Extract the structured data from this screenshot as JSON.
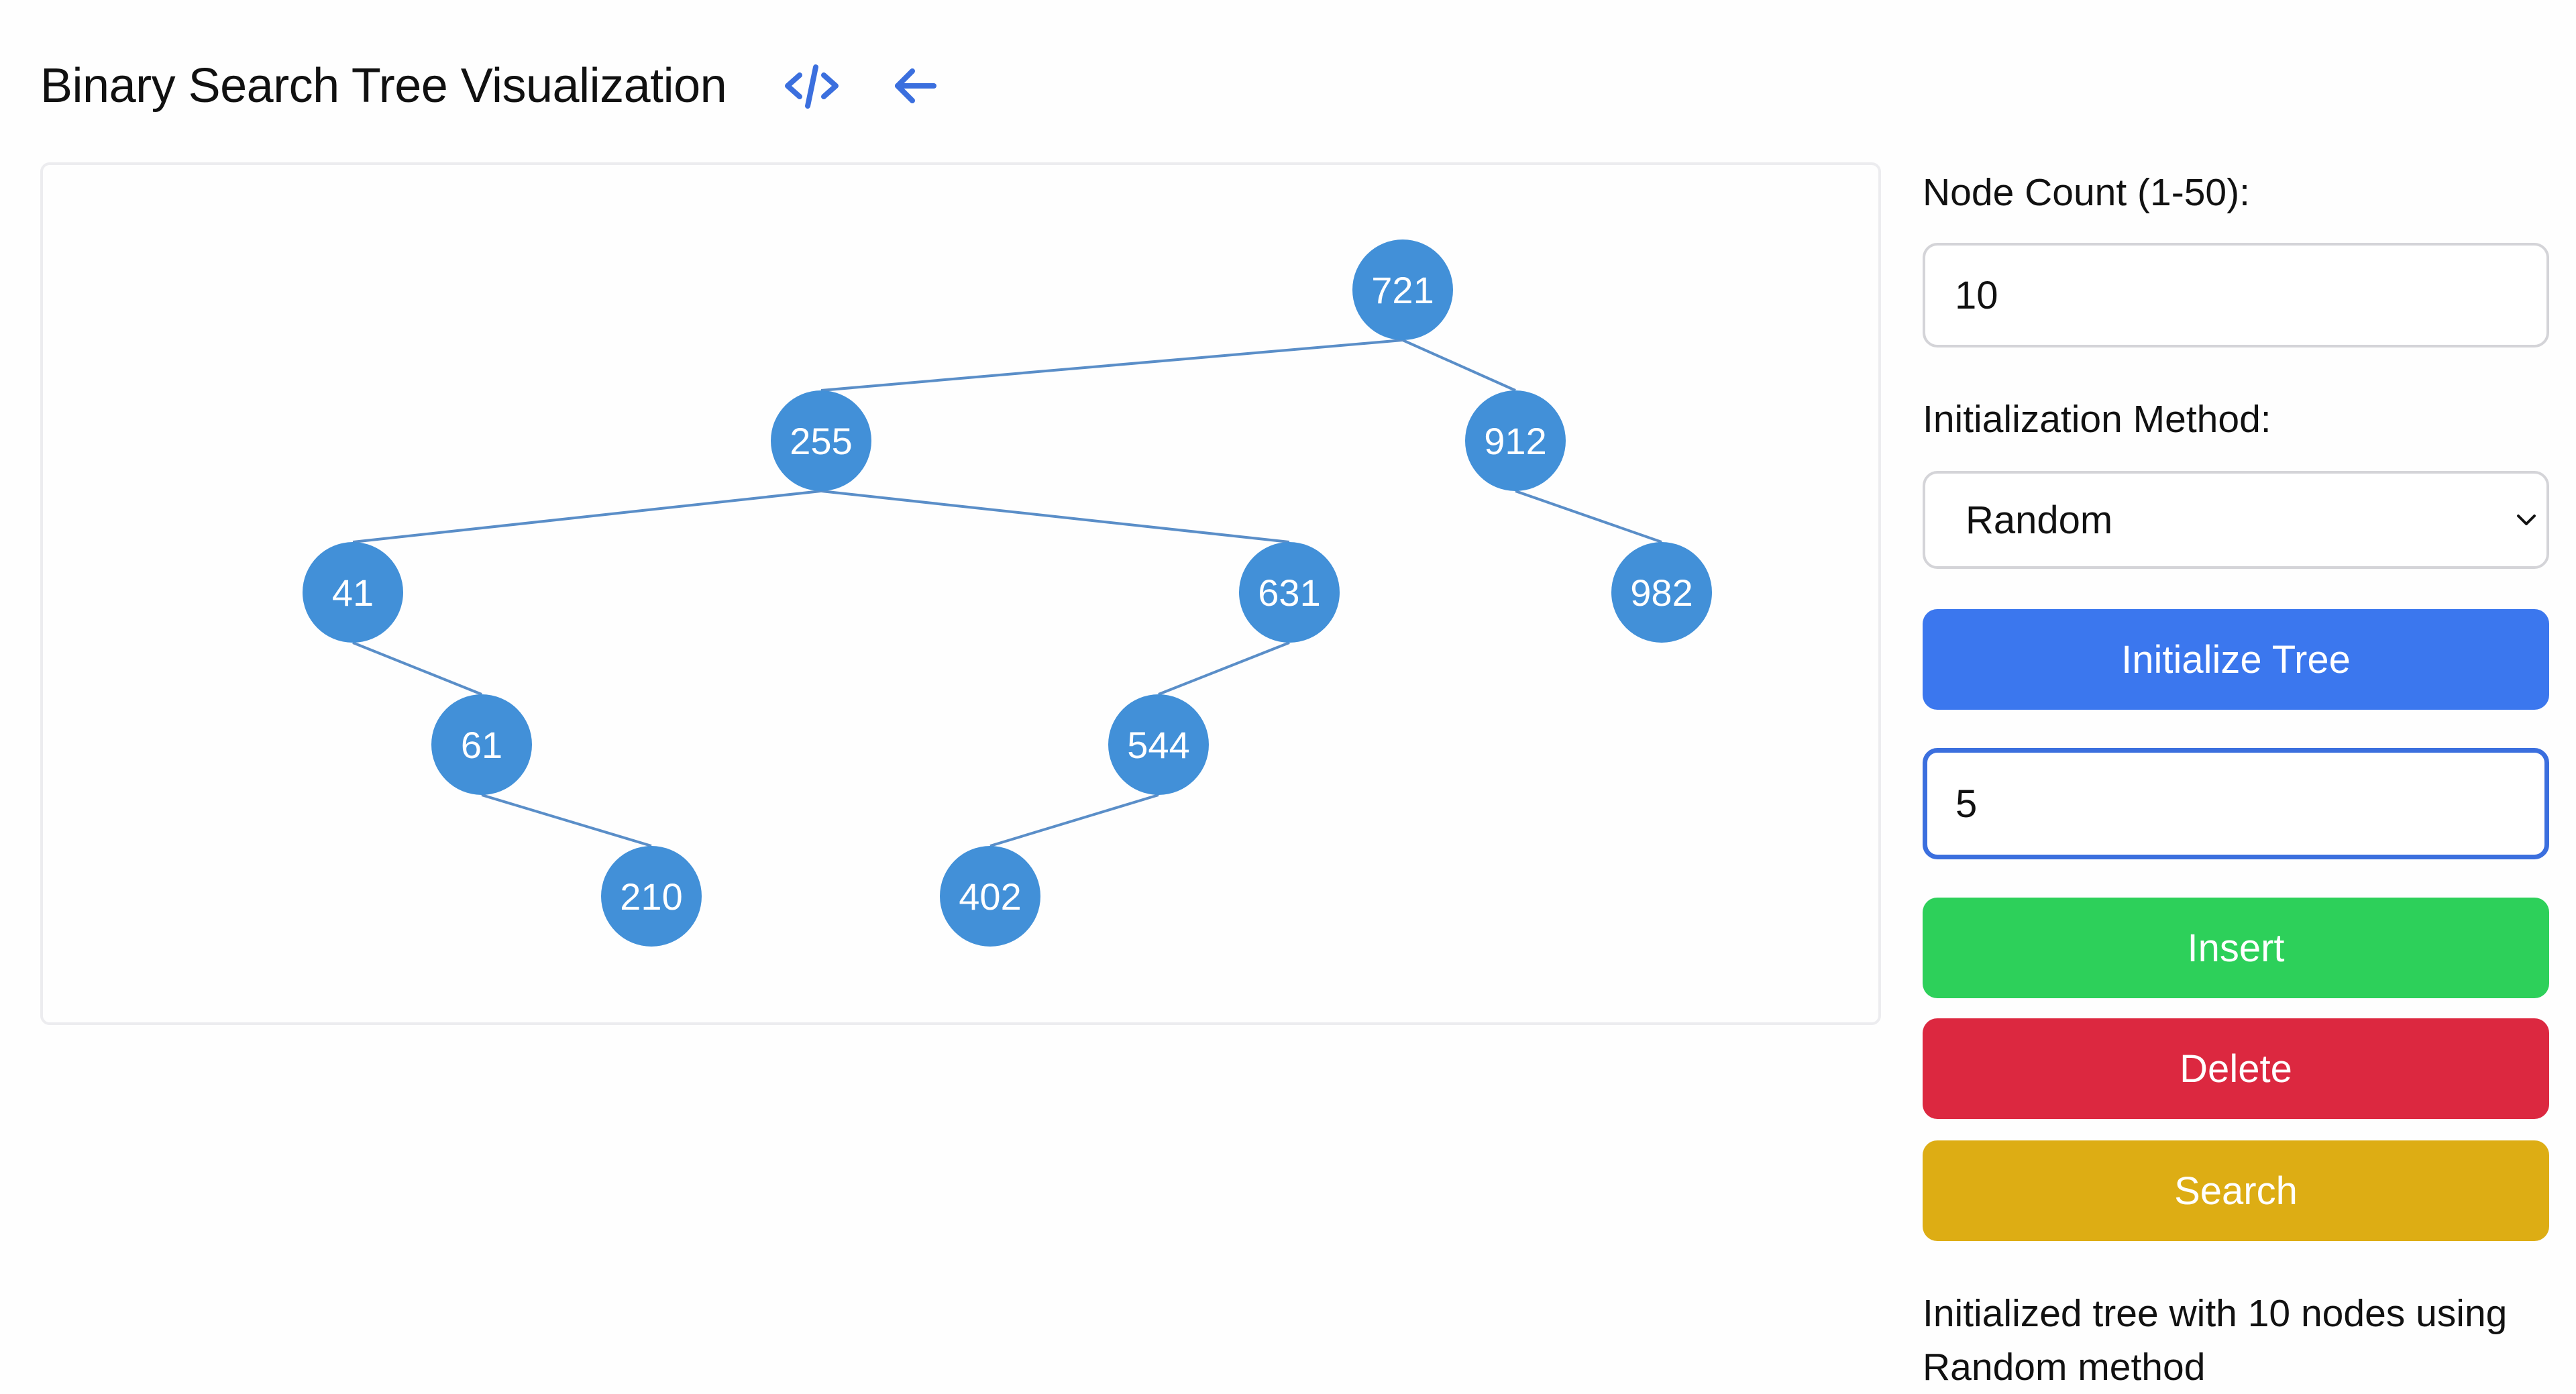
{
  "header": {
    "title": "Binary Search Tree Visualization",
    "code_icon": "code-icon",
    "back_icon": "arrow-left-icon"
  },
  "colors": {
    "accent": "#3b77ee",
    "node_fill": "#4290d8",
    "edge": "#5a8ec8",
    "insert": "#2dd05a",
    "delete": "#dc2840",
    "search": "#ddad14",
    "focus_border": "#3b6fde"
  },
  "tree": {
    "nodes": [
      {
        "id": "n721",
        "value": "721",
        "depth": 0
      },
      {
        "id": "n255",
        "value": "255",
        "depth": 1,
        "parent": "n721"
      },
      {
        "id": "n912",
        "value": "912",
        "depth": 1,
        "parent": "n721"
      },
      {
        "id": "n41",
        "value": "41",
        "depth": 2,
        "parent": "n255"
      },
      {
        "id": "n631",
        "value": "631",
        "depth": 2,
        "parent": "n255"
      },
      {
        "id": "n982",
        "value": "982",
        "depth": 2,
        "parent": "n912"
      },
      {
        "id": "n61",
        "value": "61",
        "depth": 3,
        "parent": "n41"
      },
      {
        "id": "n544",
        "value": "544",
        "depth": 3,
        "parent": "n631"
      },
      {
        "id": "n210",
        "value": "210",
        "depth": 4,
        "parent": "n61"
      },
      {
        "id": "n402",
        "value": "402",
        "depth": 4,
        "parent": "n544"
      }
    ]
  },
  "controls": {
    "node_count_label": "Node Count (1-50):",
    "node_count_value": "10",
    "init_method_label": "Initialization Method:",
    "init_method_selected": "Random",
    "initialize_button": "Initialize Tree",
    "value_input": "5",
    "insert_button": "Insert",
    "delete_button": "Delete",
    "search_button": "Search"
  },
  "status": {
    "message": "Initialized tree with 10 nodes using Random method"
  }
}
